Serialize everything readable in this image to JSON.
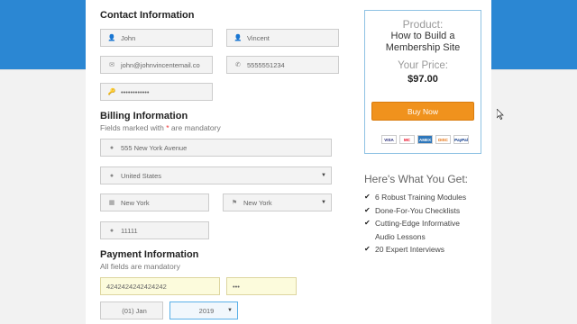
{
  "contact": {
    "title": "Contact Information",
    "first_name": "John",
    "last_name": "Vincent",
    "email": "john@johnvincentemail.co",
    "phone": "5555551234",
    "password": "••••••••••••"
  },
  "billing": {
    "title": "Billing Information",
    "subtitle_pre": "Fields marked with",
    "subtitle_star": "*",
    "subtitle_post": "are mandatory",
    "address": "555 New York Avenue",
    "country": "United States",
    "city": "New York",
    "state": "New York",
    "zip": "11111"
  },
  "payment": {
    "title": "Payment Information",
    "subtitle": "All fields are mandatory",
    "card_number": "4242424242424242",
    "cvc": "•••",
    "exp_month": "(01) Jan",
    "exp_year": "2019"
  },
  "product": {
    "label": "Product:",
    "name_line1": "How to Build a",
    "name_line2": "Membership Site",
    "price_label": "Your Price:",
    "price": "$97.00",
    "buy_label": "Buy Now",
    "cards": [
      "VISA",
      "MC",
      "AMEX",
      "DISC",
      "PayPal"
    ]
  },
  "benefits": {
    "title": "Here's What You Get:",
    "items": [
      "6 Robust Training Modules",
      "Done-For-You Checklists",
      "Cutting-Edge Informative",
      "Audio Lessons",
      "20 Expert Interviews"
    ]
  },
  "colors": {
    "header_band": "#2b87d3",
    "buy_button": "#f0921d",
    "focus_border": "#5ab0e8"
  }
}
